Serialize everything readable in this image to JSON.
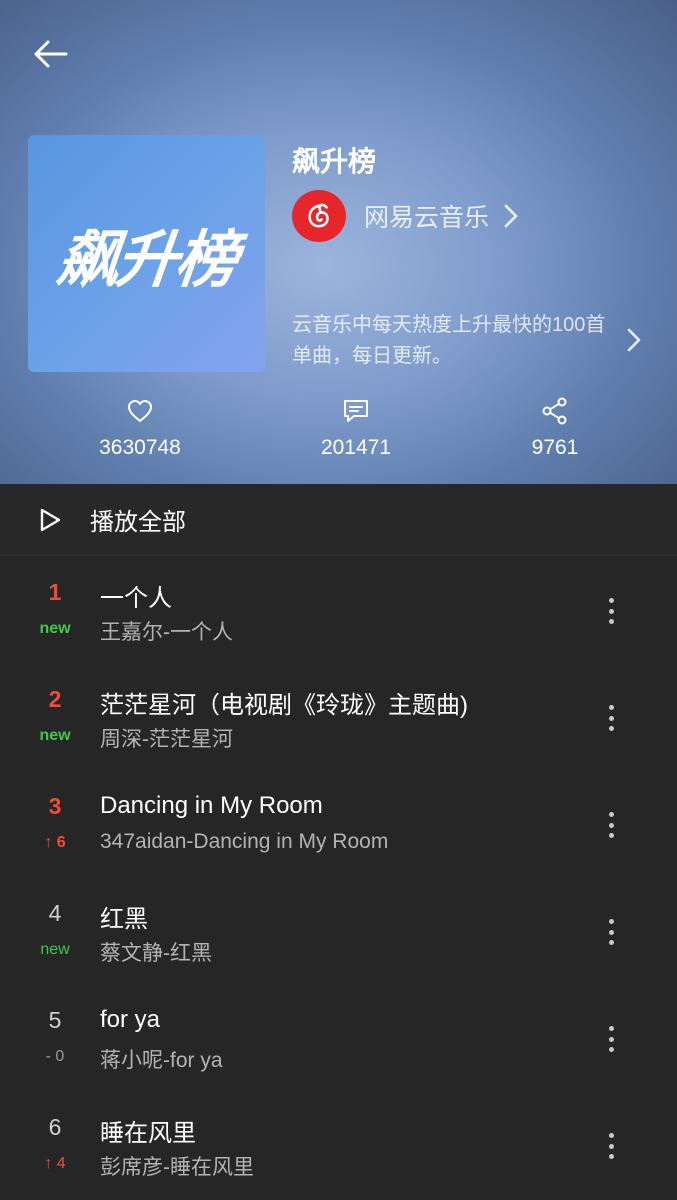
{
  "header": {
    "title": "飙升榜",
    "cover_text": "飙升榜",
    "creator": "网易云音乐",
    "description": "云音乐中每天热度上升最快的100首单曲，每日更新。"
  },
  "stats": {
    "likes": "3630748",
    "comments": "201471",
    "shares": "9761"
  },
  "play_all": {
    "label": "播放全部"
  },
  "songs": [
    {
      "rank": "1",
      "change": "new",
      "title": "一个人",
      "subtitle": "王嘉尔-一个人"
    },
    {
      "rank": "2",
      "change": "new",
      "title": "茫茫星河（电视剧《玲珑》主题曲)",
      "subtitle": "周深-茫茫星河"
    },
    {
      "rank": "3",
      "change": "↑ 6",
      "title": "Dancing in My Room",
      "subtitle": "347aidan-Dancing in My Room"
    },
    {
      "rank": "4",
      "change": "new",
      "title": "红黑",
      "subtitle": "蔡文静-红黑"
    },
    {
      "rank": "5",
      "change": "- 0",
      "title": "for ya",
      "subtitle": "蒋小呢-for ya"
    },
    {
      "rank": "6",
      "change": "↑ 4",
      "title": "睡在风里",
      "subtitle": "彭席彦-睡在风里"
    }
  ],
  "colors": {
    "accent_red": "#f04b3a",
    "new_green": "#3ec94c",
    "logo_red": "#e6262b",
    "list_bg": "#262626"
  }
}
